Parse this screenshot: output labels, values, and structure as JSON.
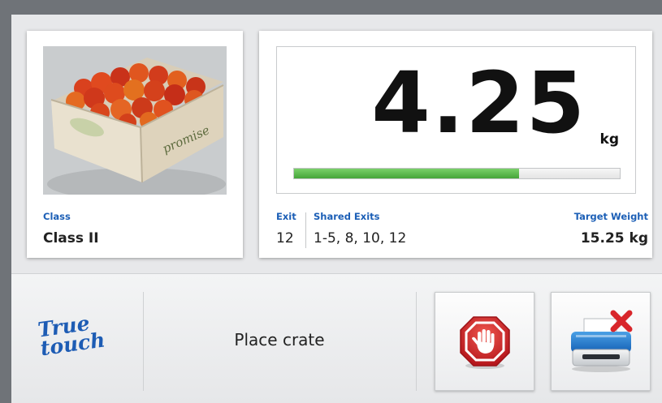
{
  "product": {
    "class_label": "Class",
    "class_value": "Class II",
    "photo_icon": "tomato-crate-photo",
    "crate_brand": "promise"
  },
  "weight": {
    "value": "4.25",
    "unit": "kg",
    "progress_fraction": 0.69,
    "progress_color": "#4caf3e"
  },
  "exit": {
    "label": "Exit",
    "value": "12"
  },
  "shared_exits": {
    "label": "Shared Exits",
    "value": "1-5, 8, 10, 12"
  },
  "target_weight": {
    "label": "Target Weight",
    "value": "15.25 kg"
  },
  "footer": {
    "logo_line1": "True",
    "logo_line2": "touch",
    "status_text": "Place crate",
    "stop_button_icon": "stop-hand-icon",
    "printer_button_icon": "printer-error-icon"
  },
  "colors": {
    "accent_blue": "#1c5fb6",
    "stop_red": "#d8262b",
    "progress_green": "#4caf3e"
  }
}
